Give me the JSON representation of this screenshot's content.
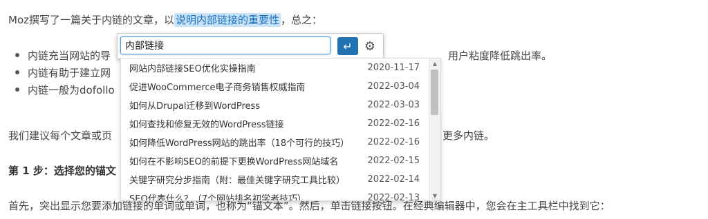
{
  "article": {
    "intro_before": "Moz撰写了一篇关于内链的文章，以",
    "intro_highlight": "说明内部链接的重要性",
    "intro_after": "，总之：",
    "bullets": [
      {
        "start": "内链充当网站的导",
        "end": "用户粘度降低跳出率。"
      },
      {
        "start": "内链有助于建立网",
        "end": ""
      },
      {
        "start": "内链一般为dofollo",
        "end": ""
      }
    ],
    "para2_start": "我们建议每个文章或页",
    "para2_end": "更多内链。",
    "step_heading": "第 1 步：选择您的锚文",
    "para3_a": "首先，突出显示您要添加链接的单词或单词，也称为",
    "para3_b": "锚文本",
    "para3_c": "。然后，单击链接按钮。在经典编辑器中，您会在主工具栏中找到它："
  },
  "link_dialog": {
    "input_value": "内部链接",
    "apply_icon": "enter-icon",
    "settings_icon": "gear-icon"
  },
  "suggestions": [
    {
      "title": "网站内部链接SEO优化实操指南",
      "date": "2020-11-17"
    },
    {
      "title": "促进WooCommerce电子商务销售权威指南",
      "date": "2022-03-04"
    },
    {
      "title": "如何从Drupal迁移到WordPress",
      "date": "2022-03-03"
    },
    {
      "title": "如何查找和修复无效的WordPress链接",
      "date": "2022-02-16"
    },
    {
      "title": "如何降低WordPress网站的跳出率（18个可行的技巧）",
      "date": "2022-02-16"
    },
    {
      "title": "如何在不影响SEO的前提下更换WordPress网站域名",
      "date": "2022-02-15"
    },
    {
      "title": "关键字研究分步指南（附：最佳关键字研究工具比较）",
      "date": "2022-02-14"
    },
    {
      "title": "SEO代表什么？（7个网站排名初学者技巧）",
      "date": "2022-02-13"
    }
  ],
  "scrollbar": {
    "thumb_position_fraction": 0.0
  }
}
